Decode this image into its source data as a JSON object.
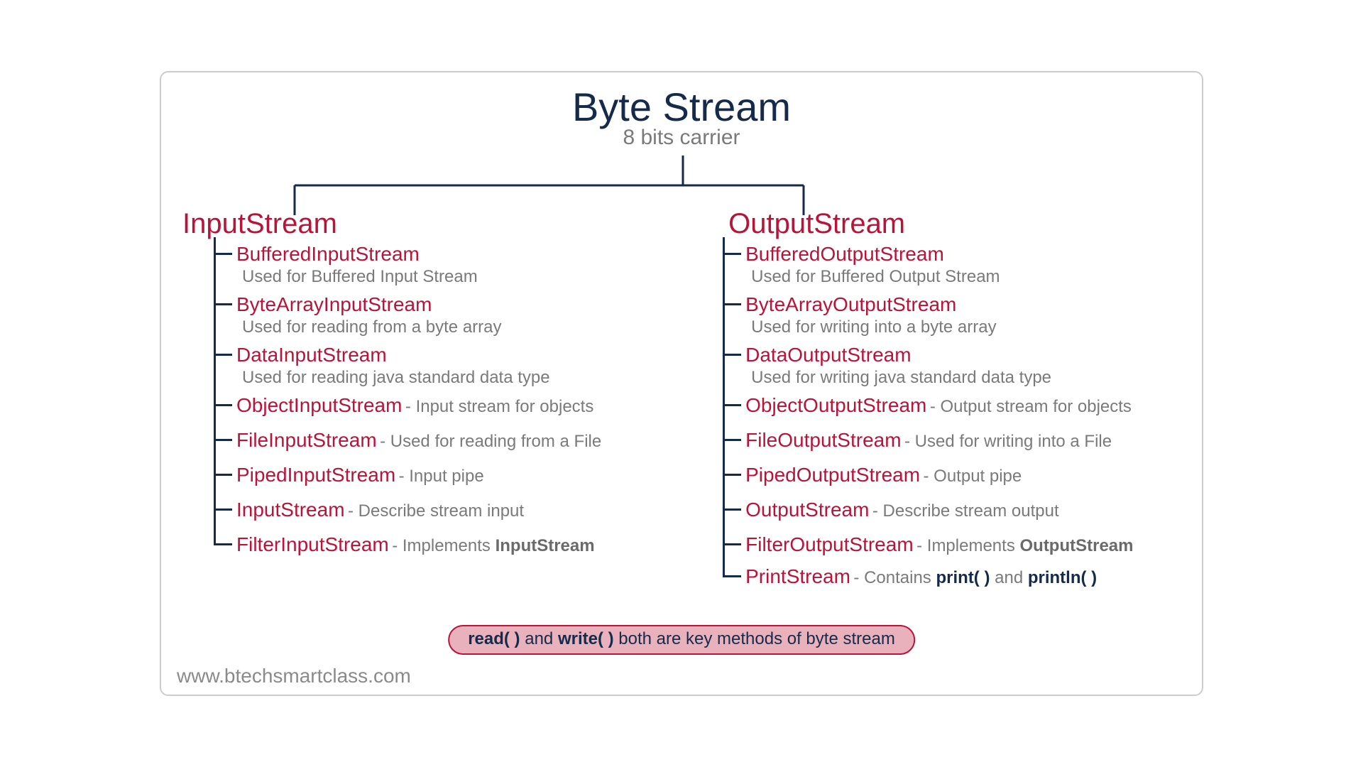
{
  "title": "Byte Stream",
  "subtitle": "8 bits carrier",
  "left": {
    "heading": "InputStream",
    "items": [
      {
        "cls": "BufferedInputStream",
        "desc": "Used for Buffered Input Stream",
        "layout": "below"
      },
      {
        "cls": "ByteArrayInputStream",
        "desc": "Used for reading from a byte array",
        "layout": "below"
      },
      {
        "cls": "DataInputStream",
        "desc": "Used for reading java standard data type",
        "layout": "below"
      },
      {
        "cls": "ObjectInputStream",
        "desc": "  - Input stream for objects",
        "layout": "inline"
      },
      {
        "cls": "FileInputStream",
        "desc": " - Used for reading from a File",
        "layout": "inline"
      },
      {
        "cls": "PipedInputStream",
        "desc": " - Input pipe",
        "layout": "inline"
      },
      {
        "cls": "InputStream",
        "desc": "  - Describe stream input",
        "layout": "inline"
      },
      {
        "cls": "FilterInputStream",
        "desc": "  - Implements ",
        "bold_suffix": "InputStream",
        "layout": "inline"
      }
    ]
  },
  "right": {
    "heading": "OutputStream",
    "items": [
      {
        "cls": "BufferedOutputStream",
        "desc": "Used for Buffered Output Stream",
        "layout": "below"
      },
      {
        "cls": "ByteArrayOutputStream",
        "desc": "Used for writing into a byte array",
        "layout": "below"
      },
      {
        "cls": "DataOutputStream",
        "desc": "Used for writing java standard data type",
        "layout": "below"
      },
      {
        "cls": "ObjectOutputStream",
        "desc": "- Output stream for objects",
        "layout": "inline"
      },
      {
        "cls": "FileOutputStream",
        "desc": "- Used for writing into a File",
        "layout": "inline"
      },
      {
        "cls": "PipedOutputStream",
        "desc": " - Output pipe",
        "layout": "inline"
      },
      {
        "cls": "OutputStream",
        "desc": "- Describe stream output",
        "layout": "inline"
      },
      {
        "cls": "FilterOutputStream",
        "desc": "- Implements ",
        "bold_suffix": "OutputStream",
        "layout": "inline"
      },
      {
        "cls": "PrintStream",
        "desc_parts": [
          "  - Contains ",
          "print( )",
          " and ",
          "println( )"
        ],
        "layout": "inline_navy"
      }
    ]
  },
  "footer": {
    "m1": "read( )",
    "mid": " and ",
    "m2": "write( )",
    "rest": " both are key methods of byte stream"
  },
  "site": "www.btechsmartclass.com"
}
